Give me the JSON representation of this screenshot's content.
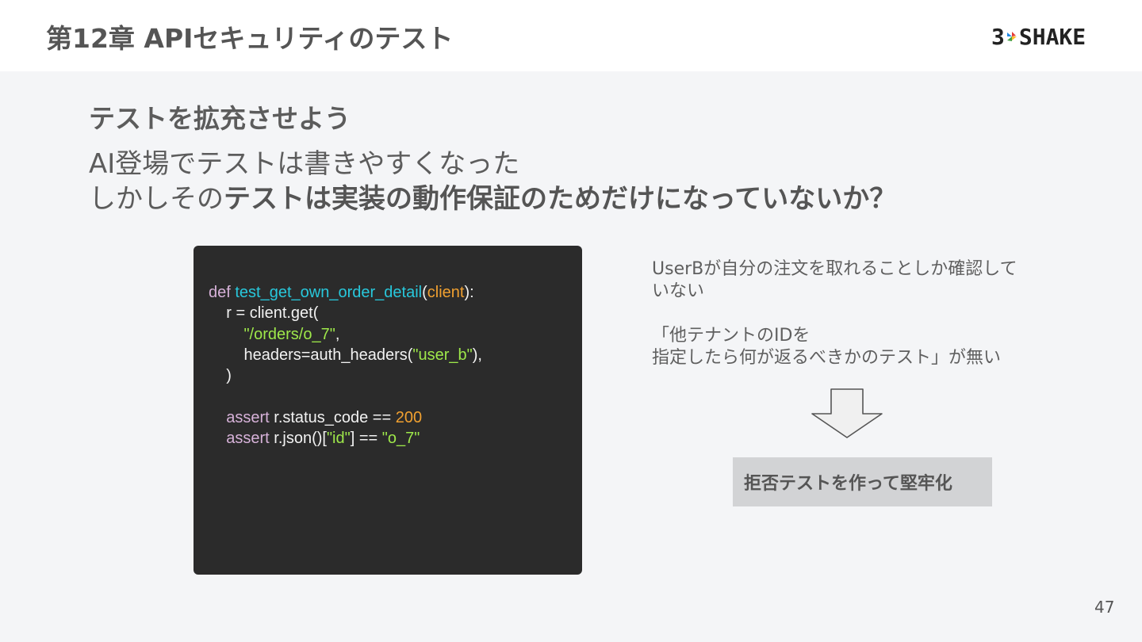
{
  "header": {
    "chapter_title": "第12章 APIセキュリティのテスト",
    "logo_left": "3",
    "logo_right": "SHAKE",
    "logo_mark_icon": "chevron-pinwheel-icon"
  },
  "slide": {
    "heading": "テストを拡充させよう",
    "lead_line1": "AI登場でテストは書きやすくなった",
    "lead_line2_plain": "しかしその",
    "lead_line2_bold": "テストは実装の動作保証のためだけになっていないか？"
  },
  "code": {
    "l1_kw": "def",
    "l1_fn": "test_get_own_order_detail",
    "l1_open": "(",
    "l1_param": "client",
    "l1_close": "):",
    "l2": "r = client.get(",
    "l3_str": "\"/orders/o_7\"",
    "l3_tail": ",",
    "l4_head": "headers=auth_headers(",
    "l4_str": "\"user_b\"",
    "l4_tail": "),",
    "l5": ")",
    "l6_kw": "assert",
    "l6_mid": " r.status_code == ",
    "l6_num": "200",
    "l7_kw": "assert",
    "l7_mid": " r.json()[",
    "l7_str1": "\"id\"",
    "l7_mid2": "] == ",
    "l7_str2": "\"o_7\""
  },
  "note": {
    "line1": "UserBが自分の注文を取れることしか確認して",
    "line2": "いない",
    "line3": "「他テナントのIDを",
    "line4": "指定したら何が返るべきかのテスト」が無い",
    "arrow_icon": "down-arrow-icon"
  },
  "callout": {
    "text": "拒否テストを作って堅牢化"
  },
  "footer": {
    "page_number": "47"
  },
  "colors": {
    "code_bg": "#2b2b2b",
    "keyword": "#d7b2d9",
    "function": "#28c8dc",
    "param": "#f0a030",
    "string": "#9ee84a",
    "number": "#f0a030",
    "callout_bg": "#d2d3d5",
    "page_bg": "#f4f5f7"
  }
}
